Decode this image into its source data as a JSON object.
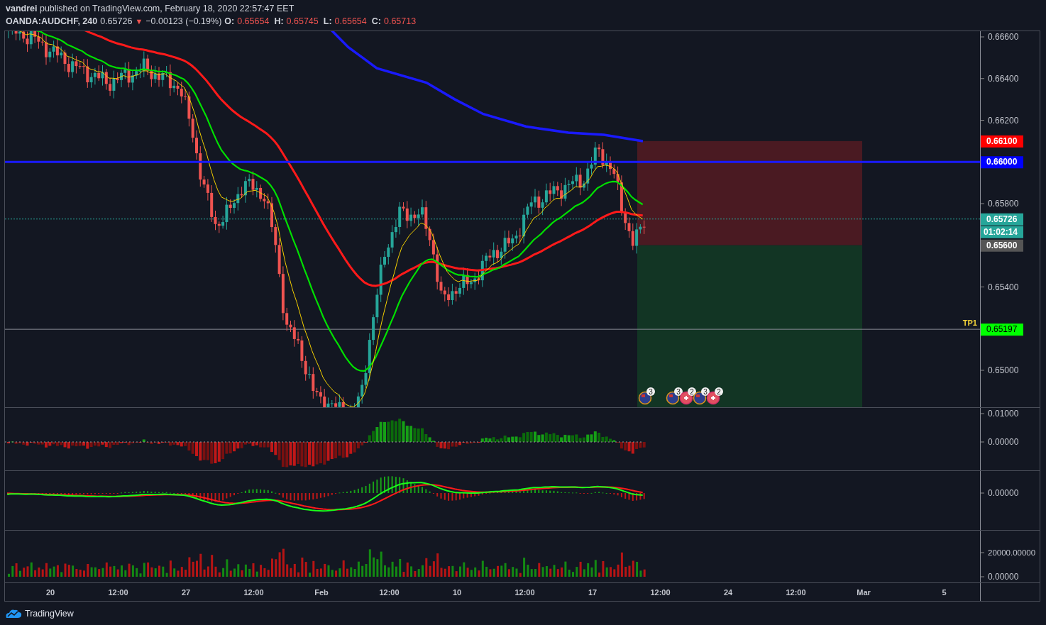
{
  "header": {
    "author": "vandrei",
    "published": "published on TradingView.com, February 18, 2020 22:57:47 EET"
  },
  "symbol_bar": {
    "symbol": "OANDA:AUDCHF, 240",
    "last": "0.65726",
    "direction": "▼",
    "change": "−0.00123 (−0.19%)",
    "ohlc": [
      {
        "label": "O:",
        "value": "0.65654"
      },
      {
        "label": "H:",
        "value": "0.65745"
      },
      {
        "label": "L:",
        "value": "0.65654"
      },
      {
        "label": "C:",
        "value": "0.65713"
      }
    ]
  },
  "main_pane": {
    "price_ticks": [
      "0.66600",
      "0.66400",
      "0.66200",
      "0.65800",
      "0.65400",
      "0.65000"
    ],
    "price_markers": [
      {
        "kind": "stop",
        "label": "0.66100",
        "color": "#ff0000"
      },
      {
        "kind": "level",
        "label": "0.66000",
        "color": "#0000ff"
      },
      {
        "kind": "last",
        "label": "0.65726",
        "color": "#26a69a"
      },
      {
        "kind": "countdown",
        "label": "01:02:14",
        "color": "#26a69a"
      },
      {
        "kind": "entry",
        "label": "0.65600",
        "color": "#555555"
      },
      {
        "kind": "target",
        "label": "0.65197",
        "color": "#00ff00"
      }
    ],
    "target_label": "TP1",
    "events": [
      {
        "counts": [
          "3"
        ]
      },
      {
        "counts": [
          "3",
          "2"
        ]
      },
      {
        "counts": [
          "3",
          "2"
        ]
      }
    ]
  },
  "oscillator_pane": {
    "ticks": [
      "0.01000",
      "0.00000"
    ]
  },
  "macd_pane": {
    "ticks": [
      "0.00000"
    ]
  },
  "volume_pane": {
    "ticks": [
      "20000.00000",
      "0.00000"
    ]
  },
  "time_axis": [
    "20",
    "12:00",
    "27",
    "12:00",
    "Feb",
    "12:00",
    "10",
    "12:00",
    "17",
    "12:00",
    "24",
    "12:00",
    "Mar",
    "5"
  ],
  "footer": {
    "brand": "TradingView"
  }
}
